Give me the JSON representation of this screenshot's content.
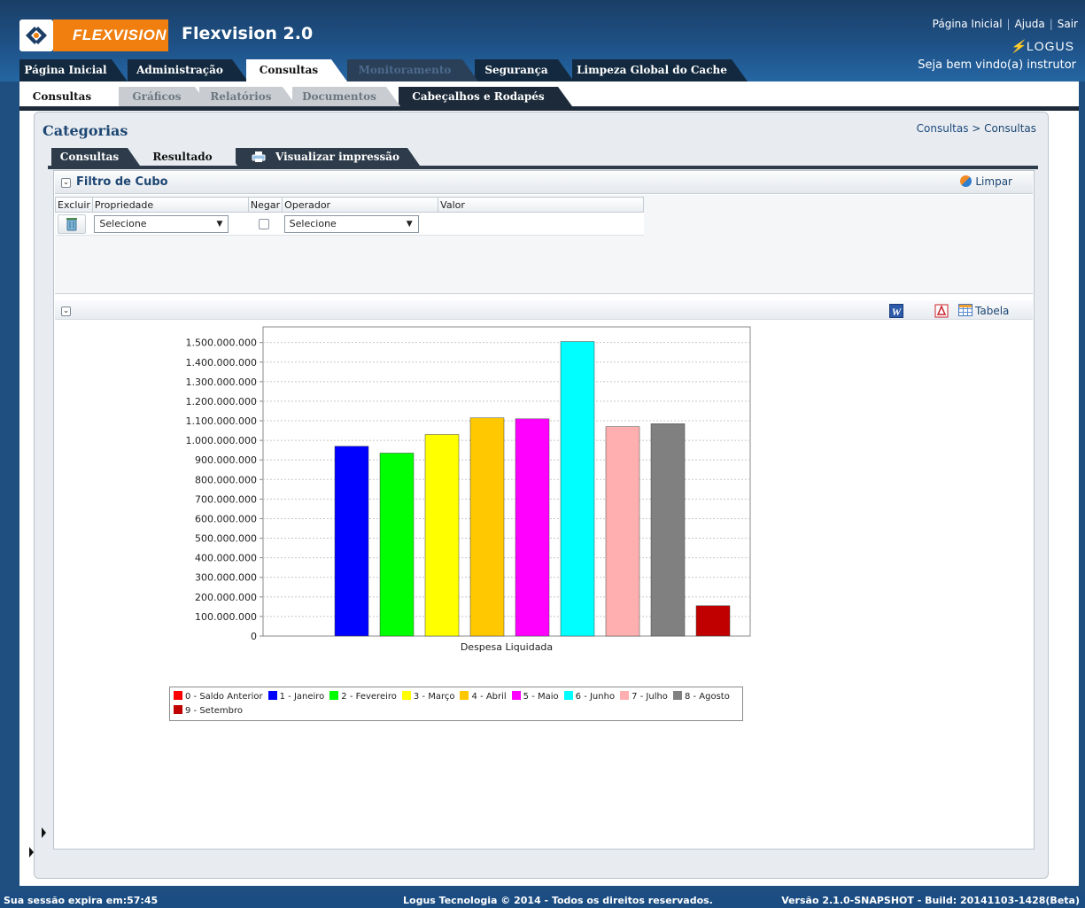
{
  "header": {
    "brand": "FLEXVISION",
    "app_title": "Flexvision 2.0",
    "links": [
      "Página Inicial",
      "Ajuda",
      "Sair"
    ],
    "company_logo": "LOGUS",
    "welcome": "Seja bem vindo(a) instrutor"
  },
  "main_tabs": [
    {
      "label": "Página Inicial",
      "state": "normal"
    },
    {
      "label": "Administração",
      "state": "normal"
    },
    {
      "label": "Consultas",
      "state": "active"
    },
    {
      "label": "Monitoramento",
      "state": "disabled"
    },
    {
      "label": "Segurança",
      "state": "normal"
    },
    {
      "label": "Limpeza Global do Cache",
      "state": "normal"
    }
  ],
  "sub_tabs": [
    {
      "label": "Consultas",
      "state": "active"
    },
    {
      "label": "Gráficos",
      "state": "inactive"
    },
    {
      "label": "Relatórios",
      "state": "inactive"
    },
    {
      "label": "Documentos",
      "state": "inactive"
    },
    {
      "label": "Cabeçalhos e Rodapés",
      "state": "dark"
    }
  ],
  "page": {
    "title": "Categorias",
    "breadcrumb": [
      "Consultas",
      "Consultas"
    ]
  },
  "inner_tabs": [
    {
      "label": "Consultas",
      "state": "normal"
    },
    {
      "label": "Resultado",
      "state": "active"
    },
    {
      "label": "Visualizar impressão",
      "state": "normal",
      "icon": "printer-icon"
    }
  ],
  "filter": {
    "title": "Filtro de Cubo",
    "clear_label": "Limpar",
    "columns": [
      "Excluir",
      "Propriedade",
      "Negar",
      "Operador",
      "Valor"
    ],
    "row": {
      "property": "Selecione",
      "negate": false,
      "operator": "Selecione",
      "value": ""
    }
  },
  "result": {
    "table_label": "Tabela",
    "export_icons": [
      "word-icon",
      "pdf-icon",
      "table-grid-icon"
    ]
  },
  "chart_data": {
    "type": "bar",
    "xlabel": "Despesa Liquidada",
    "ylim": [
      0,
      1580000000
    ],
    "yticks": [
      "0",
      "100.000.000",
      "200.000.000",
      "300.000.000",
      "400.000.000",
      "500.000.000",
      "600.000.000",
      "700.000.000",
      "800.000.000",
      "900.000.000",
      "1.000.000.000",
      "1.100.000.000",
      "1.200.000.000",
      "1.300.000.000",
      "1.400.000.000",
      "1.500.000.000"
    ],
    "grid": true,
    "legend_position": "bottom",
    "series": [
      {
        "name": "0 - Saldo Anterior",
        "value": 0,
        "color": "#ff0000"
      },
      {
        "name": "1 - Janeiro",
        "value": 970000000,
        "color": "#0000ff"
      },
      {
        "name": "2 - Fevereiro",
        "value": 935000000,
        "color": "#00ff00"
      },
      {
        "name": "3 - Março",
        "value": 1030000000,
        "color": "#ffff00"
      },
      {
        "name": "4 - Abril",
        "value": 1115000000,
        "color": "#ffc800"
      },
      {
        "name": "5 - Maio",
        "value": 1110000000,
        "color": "#ff00ff"
      },
      {
        "name": "6 - Junho",
        "value": 1505000000,
        "color": "#00ffff"
      },
      {
        "name": "7 - Julho",
        "value": 1070000000,
        "color": "#ffafaf"
      },
      {
        "name": "8 - Agosto",
        "value": 1085000000,
        "color": "#808080"
      },
      {
        "name": "9 - Setembro",
        "value": 155000000,
        "color": "#c00000"
      }
    ]
  },
  "footer": {
    "session": "Sua sessão expira em:57:45",
    "copyright": "Logus Tecnologia © 2014 - Todos os direitos reservados.",
    "version": "Versão 2.1.0-SNAPSHOT - Build: 20141103-1428(Beta)"
  }
}
